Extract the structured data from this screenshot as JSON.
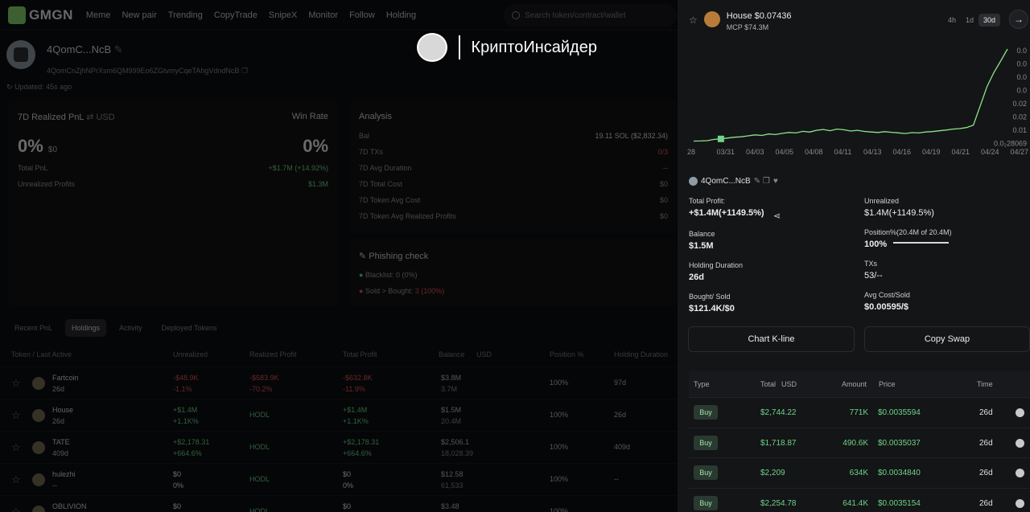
{
  "nav": {
    "brand": "GMGN",
    "links": [
      "Meme",
      "New pair",
      "Trending",
      "CopyTrade",
      "SnipeX",
      "Monitor",
      "Follow",
      "Holding"
    ],
    "search_placeholder": "Search token/contract/wallet"
  },
  "profile": {
    "name": "4QomC...NcB",
    "address": "4QomCnZjhNPrXsm6QM999Eo6ZGtvmyCqeTAhgVdndNcB",
    "updated": "Updated: 45s ago"
  },
  "pnl_card": {
    "title": "7D Realized PnL",
    "currency": "USD",
    "winrate_label": "Win Rate",
    "pnl_value": "0%",
    "pnl_usd": "$0",
    "winrate_value": "0%",
    "rows": [
      {
        "label": "Total PnL",
        "value": "+$1.7M (+14.92%)"
      },
      {
        "label": "Unrealized Profits",
        "value": "$1.3M"
      }
    ]
  },
  "analysis_card": {
    "title": "Analysis",
    "rows": [
      {
        "label": "Bal",
        "value": "19.11 SOL ($2,832.34)"
      },
      {
        "label": "7D TXs",
        "value": "0/3"
      },
      {
        "label": "7D Avg Duration",
        "value": "--"
      },
      {
        "label": "7D Total Cost",
        "value": "$0"
      },
      {
        "label": "7D Token Avg Cost",
        "value": "$0"
      },
      {
        "label": "7D Token Avg Realized Profits",
        "value": "$0"
      }
    ]
  },
  "phishing_card": {
    "title": "Phishing check",
    "blacklist": "Blacklist: 0 (0%)",
    "sold_label": "Sold > Bought:",
    "sold_value": "3 (100%)"
  },
  "tabs": [
    "Recent PnL",
    "Holdings",
    "Activity",
    "Deployed Tokens"
  ],
  "table": {
    "headers": [
      "Token / Last Active",
      "Unrealized",
      "Realized Profit",
      "Total Profit",
      "Balance",
      "USD",
      "Position %",
      "Holding Duration"
    ],
    "rows": [
      {
        "name": "Fartcoin",
        "age": "26d",
        "unreal": "-$48.9K",
        "unreal_pct": "-1.1%",
        "realized": "-$583.9K",
        "realized_pct": "-70.2%",
        "total": "-$632.8K",
        "total_pct": "-11.9%",
        "bal_usd": "$3.8M",
        "bal_amt": "3.7M",
        "pos": "100%",
        "dur": "97d"
      },
      {
        "name": "House",
        "age": "26d",
        "unreal": "+$1.4M",
        "unreal_pct": "+1.1K%",
        "realized": "HODL",
        "realized_pct": "",
        "total": "+$1.4M",
        "total_pct": "+1.1K%",
        "bal_usd": "$1.5M",
        "bal_amt": "20.4M",
        "pos": "100%",
        "dur": "26d"
      },
      {
        "name": "TATE",
        "age": "409d",
        "unreal": "+$2,178.31",
        "unreal_pct": "+664.6%",
        "realized": "HODL",
        "realized_pct": "",
        "total": "+$2,178.31",
        "total_pct": "+664.6%",
        "bal_usd": "$2,506.1",
        "bal_amt": "18,028.39",
        "pos": "100%",
        "dur": "409d"
      },
      {
        "name": "hulezhi",
        "age": "--",
        "unreal": "$0",
        "unreal_pct": "0%",
        "realized": "HODL",
        "realized_pct": "",
        "total": "$0",
        "total_pct": "0%",
        "bal_usd": "$12.58",
        "bal_amt": "61,533",
        "pos": "100%",
        "dur": "--"
      },
      {
        "name": "OBLIVION",
        "age": "",
        "unreal": "$0",
        "unreal_pct": "",
        "realized": "HODL",
        "realized_pct": "",
        "total": "$0",
        "total_pct": "",
        "bal_usd": "$3.48",
        "bal_amt": "",
        "pos": "100%",
        "dur": ""
      }
    ]
  },
  "watermark": {
    "text": "КриптоИнсайдер"
  },
  "panel": {
    "token": "House $0.07436",
    "mcp": "MCP $74.3M",
    "timeframes": [
      "4h",
      "1d",
      "30d"
    ],
    "active_tf": "30d",
    "wallet": "4QomC...NcB",
    "stats": [
      {
        "label": "Total Profit:",
        "value": "+$1.4M(+1149.5%)"
      },
      {
        "label": "Unrealized",
        "value": "$1.4M(+1149.5%)"
      },
      {
        "label": "Balance",
        "value": "$1.5M"
      },
      {
        "label": "Position%(20.4M of 20.4M)",
        "value": "100%"
      },
      {
        "label": "Holding Duration",
        "value": "26d"
      },
      {
        "label": "TXs",
        "value": "53/--"
      },
      {
        "label": "Bought/ Sold",
        "value": "$121.4K/$0"
      },
      {
        "label": "Avg Cost/Sold",
        "value": "$0.00595/$"
      }
    ],
    "buttons": [
      "Chart K-line",
      "Copy Swap"
    ],
    "tx_headers": [
      "Type",
      "Total",
      "USD",
      "Amount",
      "Price",
      "Time"
    ],
    "txs": [
      {
        "type": "Buy",
        "total": "$2,744.22",
        "amount": "771K",
        "price": "$0.0035594",
        "time": "26d"
      },
      {
        "type": "Buy",
        "total": "$1,718.87",
        "amount": "490.6K",
        "price": "$0.0035037",
        "time": "26d"
      },
      {
        "type": "Buy",
        "total": "$2,209",
        "amount": "634K",
        "price": "$0.0034840",
        "time": "26d"
      },
      {
        "type": "Buy",
        "total": "$2,254.78",
        "amount": "641.4K",
        "price": "$0.0035154",
        "time": "26d"
      }
    ]
  },
  "chart_data": {
    "type": "line",
    "x_ticks": [
      "28",
      "03/31",
      "04/03",
      "04/05",
      "04/08",
      "04/11",
      "04/13",
      "04/16",
      "04/19",
      "04/21",
      "04/24",
      "04/27"
    ],
    "y_ticks": [
      "0.0",
      "0.0",
      "0.0",
      "0.0",
      "0.02",
      "0.02",
      "0.01",
      "0.0₂806₉"
    ],
    "y_ticks_display": [
      "0.0",
      "0.0",
      "0.0",
      "0.0",
      "0.02",
      "0.02",
      "0.01",
      "0.0₂28069"
    ],
    "series": [
      {
        "values": [
          0.0028,
          0.0029,
          0.0031,
          0.0041,
          0.0045,
          0.0052,
          0.0058,
          0.0061,
          0.0069,
          0.0076,
          0.0072,
          0.0083,
          0.0079,
          0.0088,
          0.0095,
          0.0091,
          0.0104,
          0.0098,
          0.0112,
          0.0118,
          0.0109,
          0.0121,
          0.0116,
          0.0106,
          0.0112,
          0.0103,
          0.0099,
          0.0095,
          0.0101,
          0.0096,
          0.0092,
          0.0087,
          0.0094,
          0.0091,
          0.0099,
          0.0102,
          0.0108,
          0.0114,
          0.0121,
          0.0125,
          0.0133,
          0.0152,
          0.0301,
          0.0452,
          0.056,
          0.065,
          0.0744
        ]
      }
    ],
    "ylim": [
      0,
      0.08
    ]
  }
}
